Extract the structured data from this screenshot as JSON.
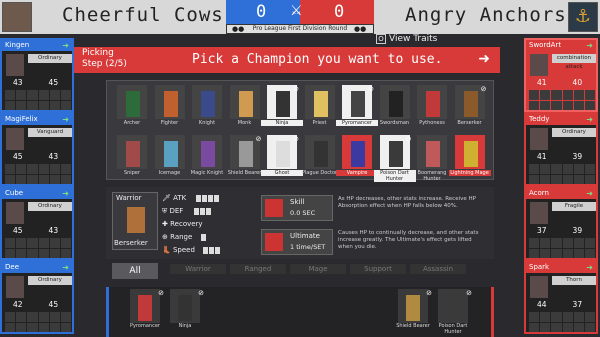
{
  "header": {
    "left_team": "Cheerful Cows",
    "right_team": "Angry Anchors",
    "left_score": "0",
    "right_score": "0",
    "league": "Pro League First Division Round"
  },
  "view_traits": {
    "key": "O",
    "label": "View Traits"
  },
  "banner": {
    "picking": "Picking",
    "step": "Step (2/5)",
    "message": "Pick a Champion you want to use."
  },
  "left_players": [
    {
      "name": "Kingen",
      "trait": "Ordinary",
      "atk": "43",
      "def": "45"
    },
    {
      "name": "MagiFelix",
      "trait": "Vanguard",
      "atk": "45",
      "def": "43"
    },
    {
      "name": "Cube",
      "trait": "Ordinary",
      "atk": "45",
      "def": "43"
    },
    {
      "name": "Dee",
      "trait": "Ordinary",
      "atk": "42",
      "def": "45"
    }
  ],
  "right_players": [
    {
      "name": "SwordArt",
      "trait": "combination attack",
      "atk": "41",
      "def": "40"
    },
    {
      "name": "Teddy",
      "trait": "Ordinary",
      "atk": "41",
      "def": "39"
    },
    {
      "name": "Acorn",
      "trait": "Fragile Mentality",
      "atk": "37",
      "def": "39"
    },
    {
      "name": "Spark",
      "trait": "Thorn",
      "atk": "44",
      "def": "37"
    }
  ],
  "champions_row1": [
    "Archer",
    "Fighter",
    "Knight",
    "Monk",
    "Ninja",
    "Priest",
    "Pyromancer",
    "Swordsman",
    "Pythoness",
    "Berserker"
  ],
  "champions_row2": [
    "Sniper",
    "Icemage",
    "Magic Knight",
    "Shield Bearer",
    "Ghost",
    "Plague Doctor",
    "Vampire",
    "Poison Dart Hunter",
    "Boomerang Hunter",
    "Lightning Mage"
  ],
  "info": {
    "class_title": "Warrior",
    "class_name": "Berserker",
    "atk": "ATK",
    "def": "DEF",
    "recovery": "Recovery",
    "range": "Range",
    "speed": "Speed",
    "skill_title": "Skill",
    "skill_sub": "0.0 SEC",
    "skill_desc": "As HP decreases, other stats increase. Receive HP Absorption effect when HP falls below 40%.",
    "ult_title": "Ultimate",
    "ult_sub": "1 time/SET",
    "ult_desc": "Causes HP to continually decrease, and other stats increase greatly. The Ultimate's effect gets lifted when you die."
  },
  "tabs": {
    "all": "All",
    "warrior": "Warrior",
    "ranged": "Ranged",
    "mage": "Mage",
    "support": "Support",
    "assassin": "Assassin"
  },
  "bottom_picks_left": [
    "Pyromancer",
    "Ninja"
  ],
  "bottom_picks_right": [
    "Shield Bearer",
    "Poison Dart Hunter"
  ],
  "colors": {
    "blue": "#2f6fd8",
    "red": "#d83a3a"
  }
}
